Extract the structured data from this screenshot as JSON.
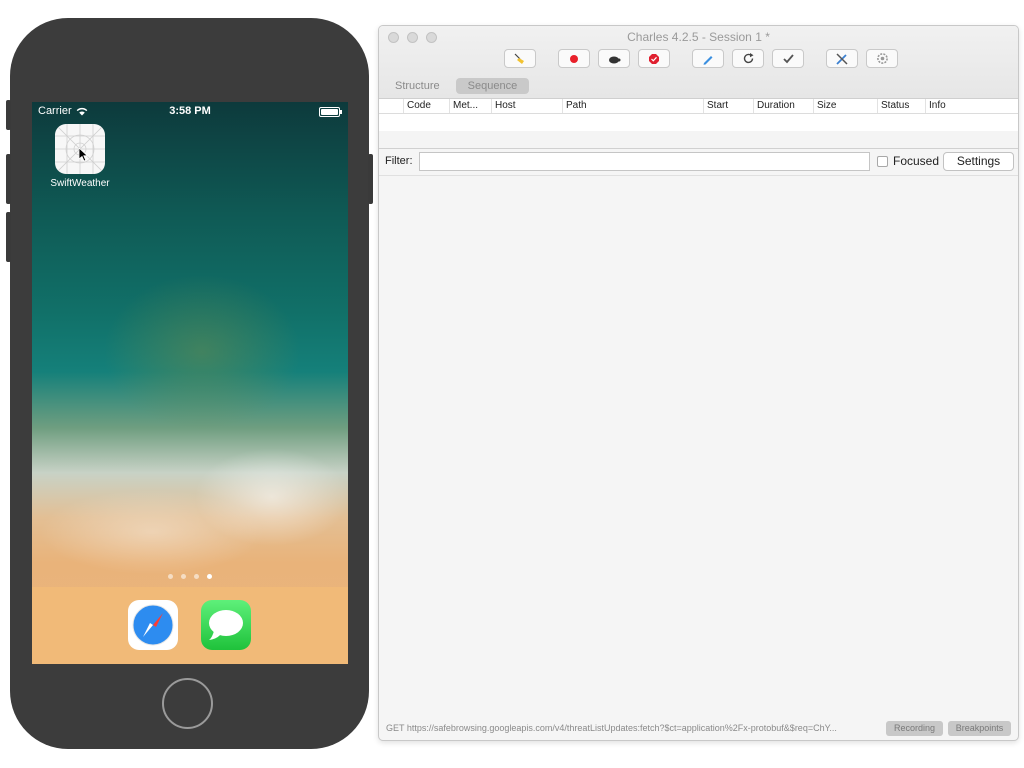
{
  "simulator": {
    "status_bar": {
      "carrier": "Carrier",
      "time": "3:58 PM"
    },
    "home_apps": [
      {
        "name": "SwiftWeather",
        "icon": "swiftweather-icon"
      }
    ],
    "page_dots": {
      "count": 4,
      "active_index": 3
    },
    "dock_apps": [
      {
        "name": "Safari",
        "icon": "safari-icon"
      },
      {
        "name": "Messages",
        "icon": "messages-icon"
      }
    ]
  },
  "charles": {
    "window_title": "Charles 4.2.5 - Session 1 *",
    "toolbar": [
      {
        "name": "broom",
        "icon": "broom-icon"
      },
      {
        "name": "record",
        "icon": "record-icon"
      },
      {
        "name": "throttle",
        "icon": "turtle-icon"
      },
      {
        "name": "breakpoints",
        "icon": "stop-icon"
      },
      {
        "name": "compose",
        "icon": "pen-icon"
      },
      {
        "name": "repeat",
        "icon": "refresh-icon"
      },
      {
        "name": "validate",
        "icon": "checkmark-icon"
      },
      {
        "name": "tools",
        "icon": "tools-icon"
      },
      {
        "name": "settings",
        "icon": "gear-icon"
      }
    ],
    "tabs": [
      {
        "label": "Structure",
        "active": false
      },
      {
        "label": "Sequence",
        "active": true
      }
    ],
    "columns": [
      "Code",
      "Met...",
      "Host",
      "Path",
      "Start",
      "Duration",
      "Size",
      "Status",
      "Info"
    ],
    "filter": {
      "label": "Filter:",
      "value": "",
      "focused_label": "Focused",
      "focused_checked": false,
      "settings_label": "Settings"
    },
    "status": {
      "text": "GET https://safebrowsing.googleapis.com/v4/threatListUpdates:fetch?$ct=application%2Fx-protobuf&$req=ChY...",
      "recording_label": "Recording",
      "breakpoints_label": "Breakpoints"
    }
  }
}
